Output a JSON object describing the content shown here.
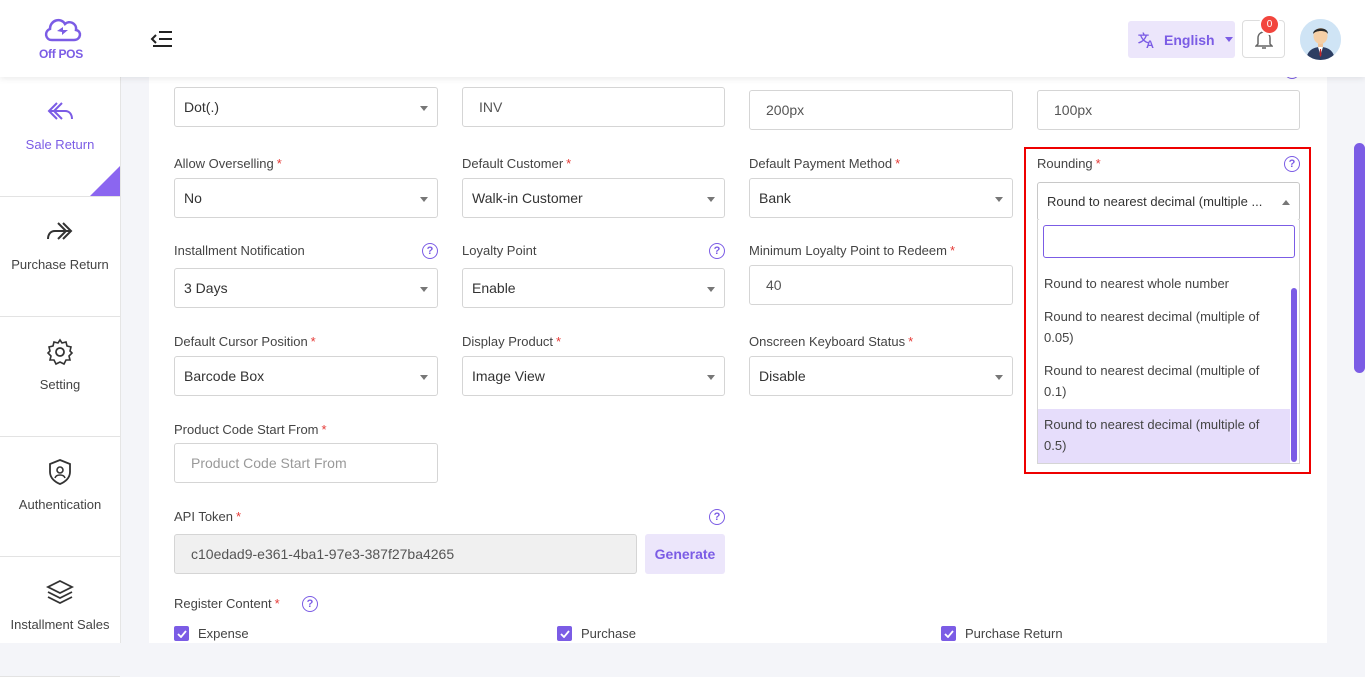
{
  "app": {
    "logo_text": "Off POS"
  },
  "header": {
    "language": "English",
    "notification_count": "0"
  },
  "sidebar": {
    "items": [
      {
        "label": "Sale Return",
        "icon": "sale-return-icon",
        "active": true
      },
      {
        "label": "Purchase Return",
        "icon": "purchase-return-icon"
      },
      {
        "label": "Setting",
        "icon": "gear-icon"
      },
      {
        "label": "Authentication",
        "icon": "shield-icon"
      },
      {
        "label": "Installment Sales",
        "icon": "layers-icon"
      }
    ]
  },
  "form": {
    "top_row": {
      "separator_value": "Dot(.)",
      "invoice_prefix_value": "INV",
      "width_value": "200px",
      "height_value": "100px"
    },
    "allow_overselling": {
      "label": "Allow Overselling",
      "value": "No"
    },
    "default_customer": {
      "label": "Default Customer",
      "value": "Walk-in Customer"
    },
    "default_payment_method": {
      "label": "Default Payment Method",
      "value": "Bank"
    },
    "rounding": {
      "label": "Rounding",
      "value": "Round to nearest decimal (multiple ...",
      "search_value": "",
      "options": [
        "Round to nearest whole number",
        "Round to nearest decimal (multiple of 0.05)",
        "Round to nearest decimal (multiple of 0.1)",
        "Round to nearest decimal (multiple of 0.5)"
      ],
      "selected_index": 3
    },
    "installment_notification": {
      "label": "Installment Notification",
      "value": "3 Days"
    },
    "loyalty_point": {
      "label": "Loyalty Point",
      "value": "Enable"
    },
    "min_loyalty_point": {
      "label": "Minimum Loyalty Point to Redeem",
      "value": "40"
    },
    "default_cursor_position": {
      "label": "Default Cursor Position",
      "value": "Barcode Box"
    },
    "display_product": {
      "label": "Display Product",
      "value": "Image View"
    },
    "onscreen_keyboard": {
      "label": "Onscreen Keyboard Status",
      "value": "Disable"
    },
    "product_code_start": {
      "label": "Product Code Start From",
      "placeholder": "Product Code Start From"
    },
    "api_token": {
      "label": "API Token",
      "value": "c10edad9-e361-4ba1-97e3-387f27ba4265",
      "button": "Generate"
    },
    "register_content": {
      "label": "Register Content",
      "items": [
        "Expense",
        "Purchase",
        "Purchase Return"
      ]
    }
  },
  "colors": {
    "accent": "#7b5ce5",
    "required": "#e53935",
    "highlight": "#ee0000"
  }
}
